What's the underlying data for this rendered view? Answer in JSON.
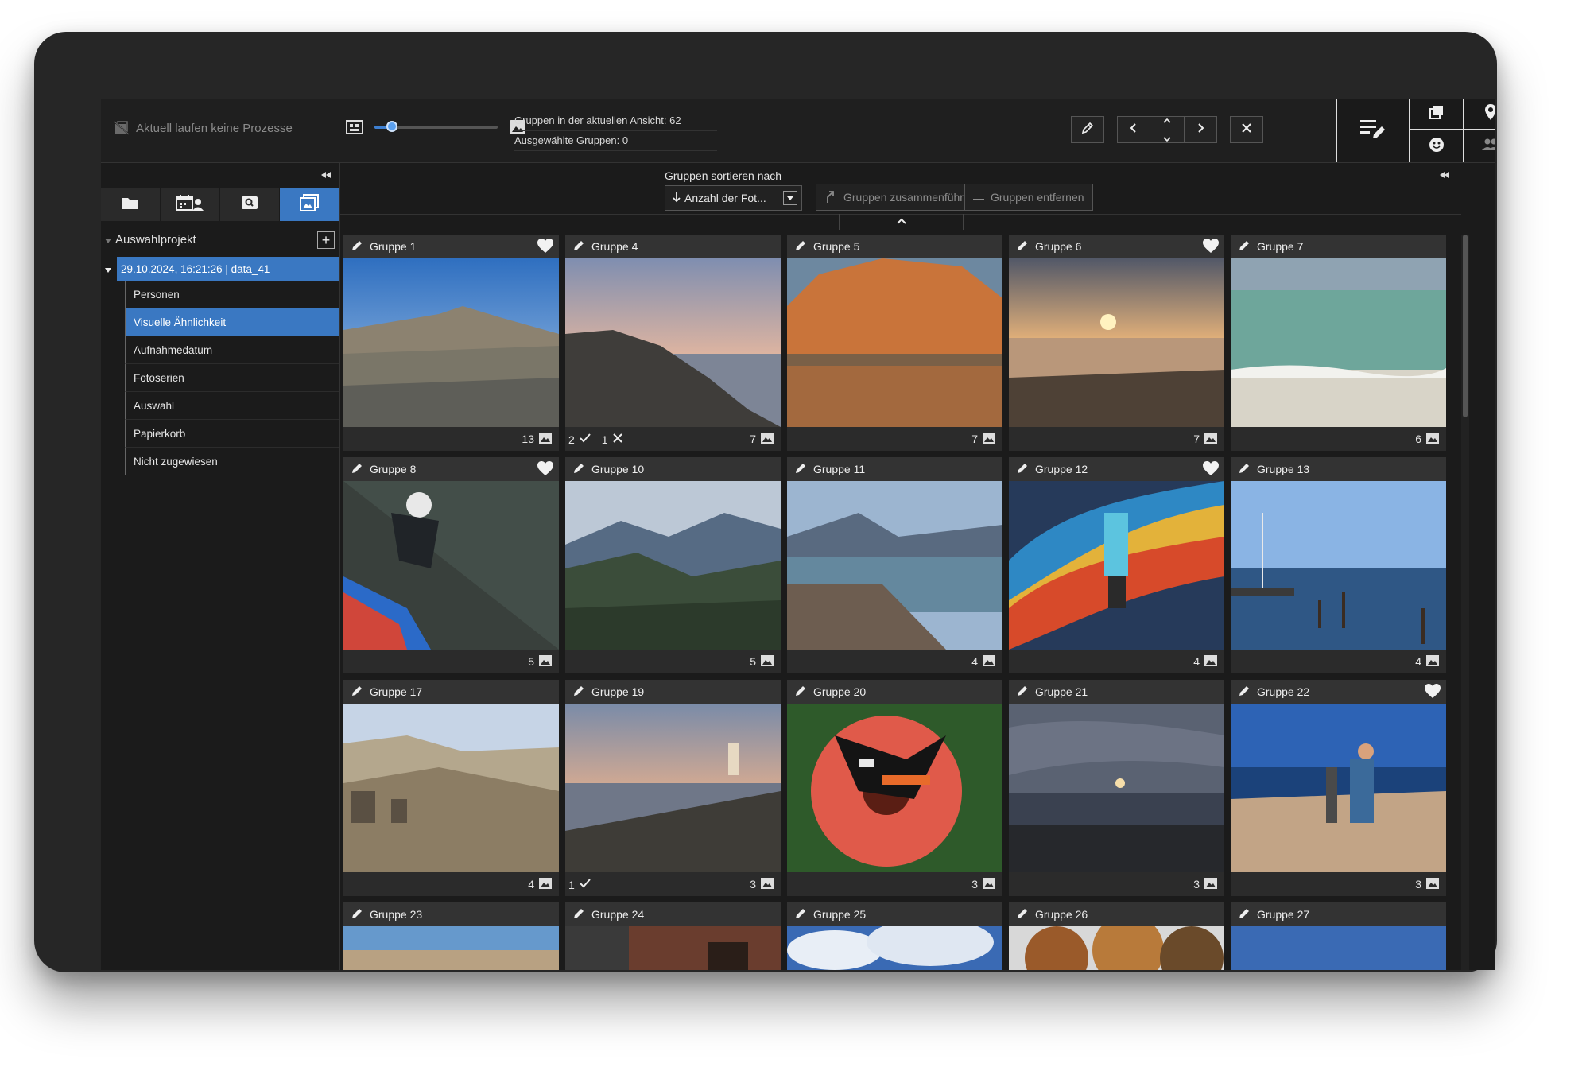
{
  "status": {
    "processes": "Aktuell laufen keine Prozesse"
  },
  "zoom": {
    "level": 0.14
  },
  "stats": {
    "groups_in_view": "Gruppen in der aktuellen Ansicht: 62",
    "selected_groups": "Ausgewählte Gruppen: 0"
  },
  "sidebar": {
    "project": "Auswahlprojekt",
    "dataset": "29.10.2024, 16:21:26 | data_41",
    "items": [
      "Personen",
      "Visuelle Ähnlichkeit",
      "Aufnahmedatum",
      "Fotoserien",
      "Auswahl",
      "Papierkorb",
      "Nicht zugewiesen"
    ],
    "selected_item": "Visuelle Ähnlichkeit"
  },
  "sort": {
    "label": "Gruppen sortieren nach",
    "value": "Anzahl der Fot..."
  },
  "actions": {
    "merge": "Gruppen zusammenführen",
    "remove": "Gruppen entfernen"
  },
  "colors": {
    "accent": "#3a78c2",
    "background": "#1b1b1b"
  },
  "groups": [
    {
      "name": "Gruppe 1",
      "count": "13",
      "fav": true,
      "checks": "",
      "rejects": "",
      "photo": "city"
    },
    {
      "name": "Gruppe 4",
      "count": "7",
      "fav": false,
      "checks": "2",
      "rejects": "1",
      "photo": "cliff"
    },
    {
      "name": "Gruppe 5",
      "count": "7",
      "fav": false,
      "checks": "",
      "rejects": "",
      "photo": "rock"
    },
    {
      "name": "Gruppe 6",
      "count": "7",
      "fav": true,
      "checks": "",
      "rejects": "",
      "photo": "sunset"
    },
    {
      "name": "Gruppe 7",
      "count": "6",
      "fav": false,
      "checks": "",
      "rejects": "",
      "photo": "sea"
    },
    {
      "name": "Gruppe 8",
      "count": "5",
      "fav": true,
      "checks": "",
      "rejects": "",
      "photo": "surf"
    },
    {
      "name": "Gruppe 10",
      "count": "5",
      "fav": false,
      "checks": "",
      "rejects": "",
      "photo": "mountain"
    },
    {
      "name": "Gruppe 11",
      "count": "4",
      "fav": false,
      "checks": "",
      "rejects": "",
      "photo": "lake"
    },
    {
      "name": "Gruppe 12",
      "count": "4",
      "fav": true,
      "checks": "",
      "rejects": "",
      "photo": "rainbow"
    },
    {
      "name": "Gruppe 13",
      "count": "4",
      "fav": false,
      "checks": "",
      "rejects": "",
      "photo": "harbor"
    },
    {
      "name": "Gruppe 17",
      "count": "4",
      "fav": false,
      "checks": "",
      "rejects": "",
      "photo": "oldtown"
    },
    {
      "name": "Gruppe 19",
      "count": "3",
      "fav": false,
      "checks": "1",
      "rejects": "",
      "photo": "lighthouse"
    },
    {
      "name": "Gruppe 20",
      "count": "3",
      "fav": false,
      "checks": "",
      "rejects": "",
      "photo": "flower"
    },
    {
      "name": "Gruppe 21",
      "count": "3",
      "fav": false,
      "checks": "",
      "rejects": "",
      "photo": "beach"
    },
    {
      "name": "Gruppe 22",
      "count": "3",
      "fav": true,
      "checks": "",
      "rejects": "",
      "photo": "viewer"
    },
    {
      "name": "Gruppe 23",
      "count": "",
      "fav": false,
      "checks": "",
      "rejects": "",
      "photo": "coast"
    },
    {
      "name": "Gruppe 24",
      "count": "",
      "fav": false,
      "checks": "",
      "rejects": "",
      "photo": "brick"
    },
    {
      "name": "Gruppe 25",
      "count": "",
      "fav": false,
      "checks": "",
      "rejects": "",
      "photo": "clouds"
    },
    {
      "name": "Gruppe 26",
      "count": "",
      "fav": false,
      "checks": "",
      "rejects": "",
      "photo": "autumn"
    },
    {
      "name": "Gruppe 27",
      "count": "",
      "fav": false,
      "checks": "",
      "rejects": "",
      "photo": "sky"
    }
  ]
}
